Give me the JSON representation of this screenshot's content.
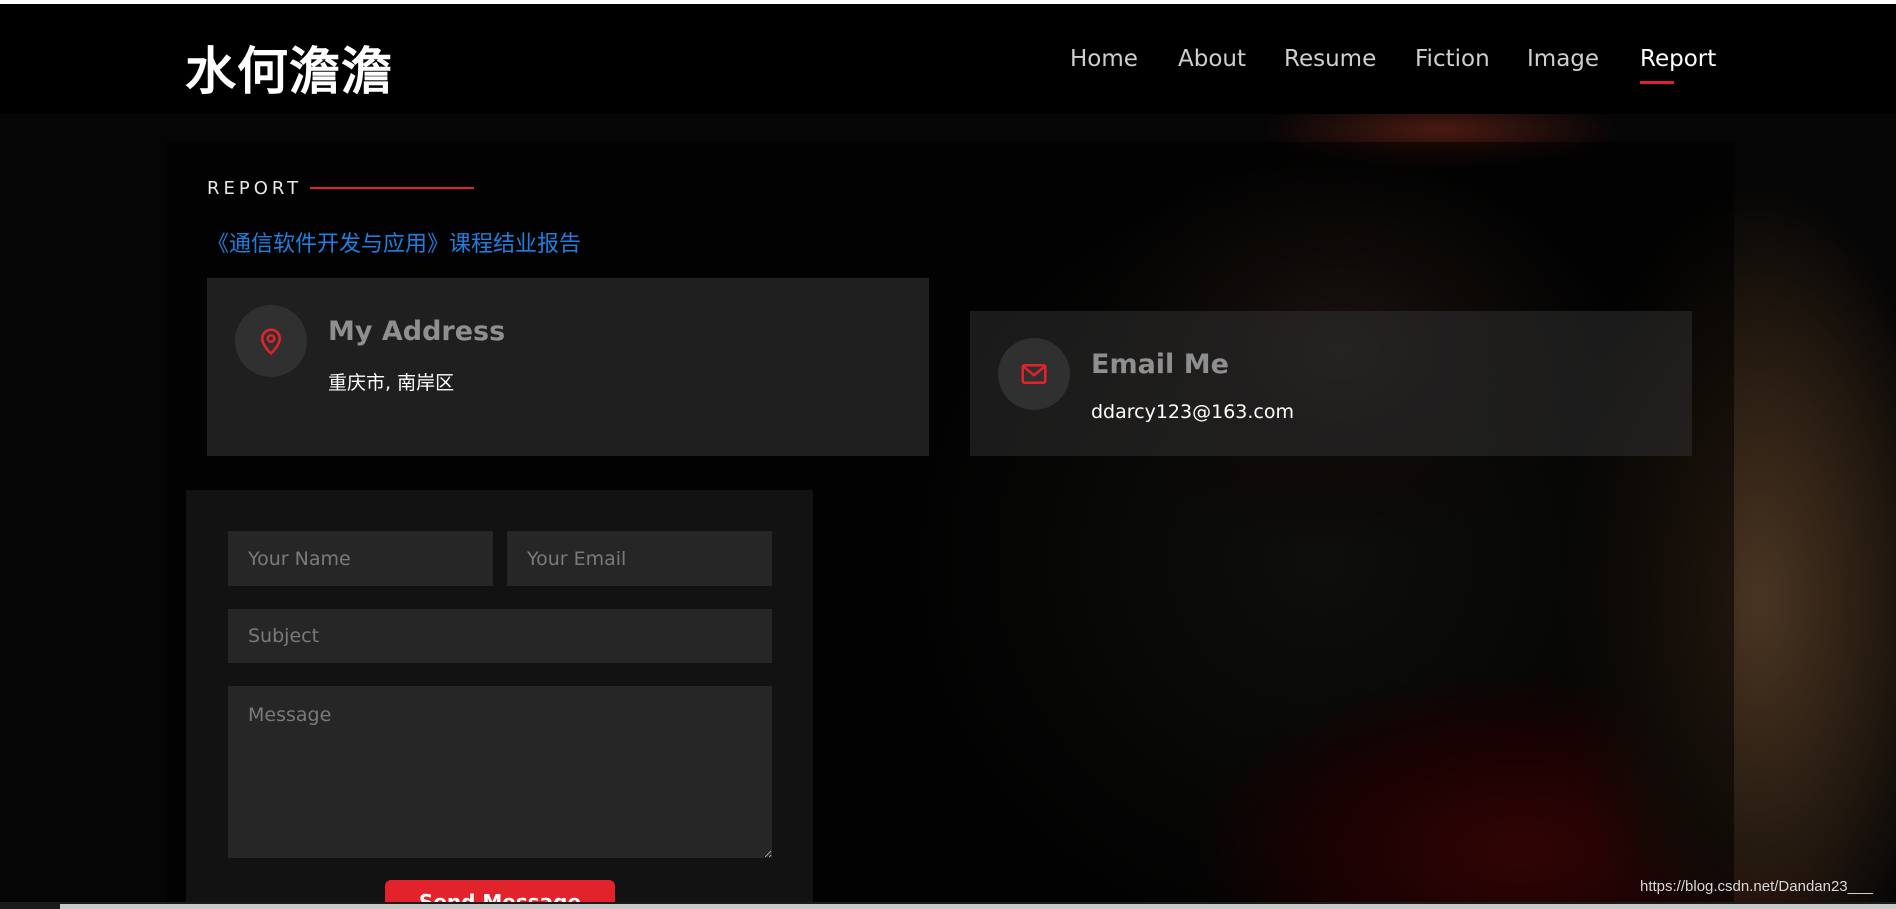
{
  "header": {
    "logo": "水何澹澹",
    "nav": [
      {
        "label": "Home"
      },
      {
        "label": "About"
      },
      {
        "label": "Resume"
      },
      {
        "label": "Fiction"
      },
      {
        "label": "Image"
      },
      {
        "label": "Report",
        "active": true
      }
    ]
  },
  "section": {
    "tag": "REPORT",
    "link_text": "《通信软件开发与应用》课程结业报告"
  },
  "address_card": {
    "icon": "location-pin-icon",
    "title": "My Address",
    "value": "重庆市, 南岸区"
  },
  "email_card": {
    "icon": "envelope-icon",
    "title": "Email Me",
    "value": "ddarcy123@163.com"
  },
  "form": {
    "name_placeholder": "Your Name",
    "email_placeholder": "Your Email",
    "subject_placeholder": "Subject",
    "message_placeholder": "Message",
    "send_label": "Send Message"
  },
  "watermark": "https://blog.csdn.net/Dandan23___",
  "colors": {
    "accent": "#e3232c",
    "link": "#1f7fe0",
    "card_bg": "#282828"
  }
}
